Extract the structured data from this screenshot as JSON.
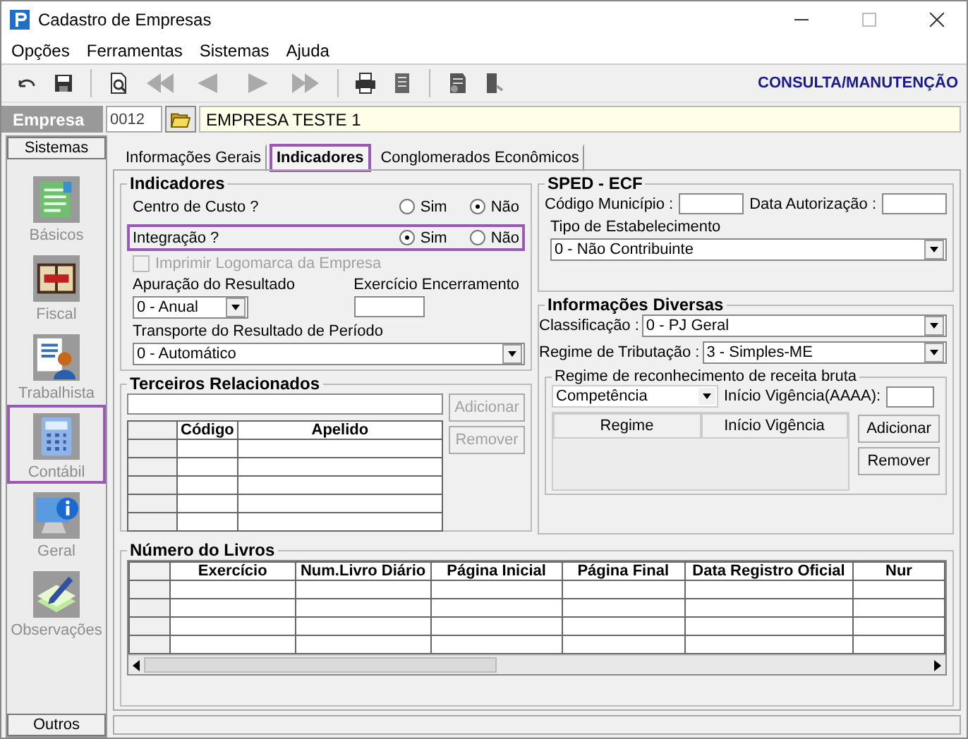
{
  "window": {
    "title": "Cadastro de Empresas"
  },
  "menu": [
    {
      "label": "Opções"
    },
    {
      "label": "Ferramentas"
    },
    {
      "label": "Sistemas"
    },
    {
      "label": "Ajuda"
    }
  ],
  "toolbar": {
    "mode": "CONSULTA/MANUTENÇÃO"
  },
  "empresa": {
    "label": "Empresa",
    "code": "0012",
    "name": "EMPRESA TESTE 1"
  },
  "sidebar": {
    "header": "Sistemas",
    "items": [
      {
        "label": "Básicos",
        "kind": "form",
        "selected": false
      },
      {
        "label": "Fiscal",
        "kind": "book",
        "selected": false
      },
      {
        "label": "Trabalhista",
        "kind": "person",
        "selected": false
      },
      {
        "label": "Contábil",
        "kind": "calculator",
        "selected": true
      },
      {
        "label": "Geral",
        "kind": "info",
        "selected": false
      },
      {
        "label": "Observações",
        "kind": "note",
        "selected": false
      }
    ],
    "footer": "Outros"
  },
  "tabs": [
    {
      "label": "Informações Gerais",
      "selected": false
    },
    {
      "label": "Indicadores",
      "selected": true
    },
    {
      "label": "Conglomerados Econômicos",
      "selected": false
    }
  ],
  "indicadores": {
    "title": "Indicadores",
    "rows": [
      {
        "label": "Centro de Custo ?",
        "highlighted": false,
        "choices": [
          {
            "label": "Sim",
            "selected": false
          },
          {
            "label": "Não",
            "selected": true
          }
        ]
      },
      {
        "label": "Integração ?",
        "highlighted": true,
        "choices": [
          {
            "label": "Sim",
            "selected": true
          },
          {
            "label": "Não",
            "selected": false
          }
        ]
      }
    ],
    "logomarca": {
      "label": "Imprimir Logomarca da Empresa",
      "checked": false,
      "disabled": true
    },
    "apuracao": {
      "label": "Apuração do Resultado",
      "value": "0 - Anual"
    },
    "exercicio": {
      "label": "Exercício Encerramento"
    },
    "transporte": {
      "label": "Transporte do Resultado de Período",
      "value": "0 - Automático"
    }
  },
  "terceiros": {
    "title": "Terceiros Relacionados",
    "buttons": [
      {
        "label": "Adicionar",
        "disabled": true
      },
      {
        "label": "Remover",
        "disabled": true
      }
    ],
    "columns": [
      "Código",
      "Apelido"
    ]
  },
  "sped": {
    "title": "SPED - ECF",
    "codigo_label": "Código Município :",
    "data_label": "Data Autorização :",
    "tipo_label": "Tipo de Estabelecimento",
    "tipo_value": "0 - Não Contribuinte"
  },
  "diversas": {
    "title": "Informações Diversas",
    "classificacao_label": "Classificação :",
    "classificacao_value": "0 - PJ Geral",
    "regime_label": "Regime de Tributação :",
    "regime_value": "3 - Simples-ME",
    "receita": {
      "title": "Regime de reconhecimento de receita bruta",
      "value": "Competência",
      "inicio_label": "Início Vigência(AAAA):",
      "columns": [
        "Regime",
        "Início Vigência"
      ],
      "buttons": [
        "Adicionar",
        "Remover"
      ]
    }
  },
  "livros": {
    "title": "Número do Livros",
    "columns": [
      "Exercício",
      "Num.Livro Diário",
      "Página Inicial",
      "Página Final",
      "Data Registro Oficial",
      "Nur"
    ]
  }
}
